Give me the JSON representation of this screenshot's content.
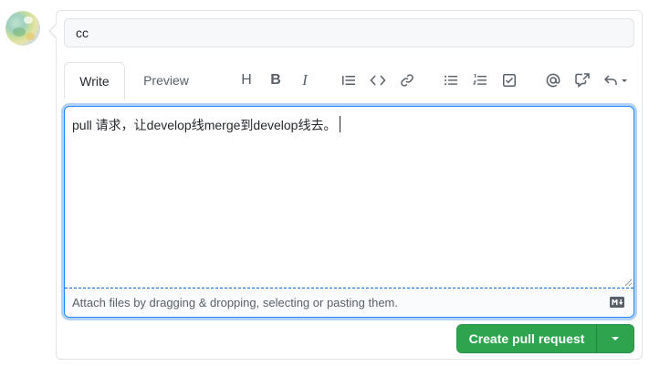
{
  "title_field": {
    "value": "cc"
  },
  "tabs": {
    "write": "Write",
    "preview": "Preview"
  },
  "toolbar": {
    "heading": "H",
    "bold": "B",
    "italic": "I"
  },
  "editor": {
    "body_text": "pull 请求，让develop线merge到develop线去。",
    "attach_hint": "Attach files by dragging & dropping, selecting or pasting them."
  },
  "actions": {
    "create_label": "Create pull request"
  },
  "colors": {
    "accent_green": "#2ea44f",
    "focus_blue": "#2188ff",
    "muted_text": "#586069",
    "border": "#e1e4e8"
  },
  "icons": {
    "heading": "heading-icon",
    "bold": "bold-icon",
    "italic": "italic-icon",
    "quote": "quote-icon",
    "code": "code-icon",
    "link": "link-icon",
    "bullet_list": "bullet-list-icon",
    "numbered_list": "numbered-list-icon",
    "task_list": "task-list-icon",
    "mention": "mention-icon",
    "reference": "cross-reference-icon",
    "reply": "reply-icon",
    "markdown": "markdown-icon"
  }
}
